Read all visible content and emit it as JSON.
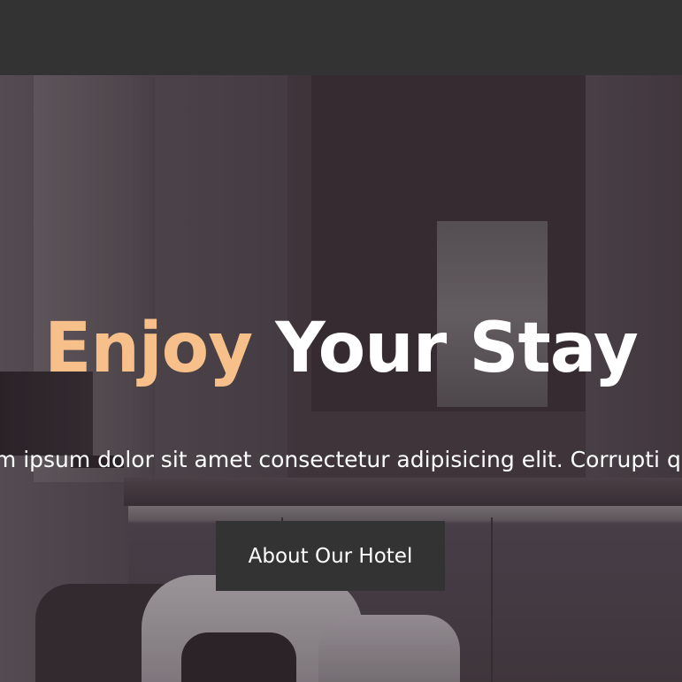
{
  "hero": {
    "title_accent": "Enjoy",
    "title_rest": "Your Stay",
    "subtitle": "Lorem ipsum dolor sit amet consectetur adipisicing elit. Corrupti quod sapiente iusto",
    "cta_label": "About Our Hotel"
  },
  "colors": {
    "accent": "#f7c08a",
    "header_bg": "#333333",
    "button_bg": "#333333",
    "text": "#ffffff"
  }
}
